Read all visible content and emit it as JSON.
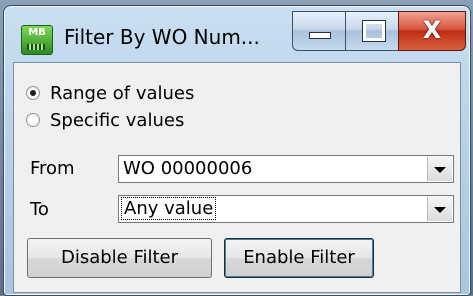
{
  "window": {
    "title": "Filter By WO Num...",
    "app_icon_text": "MB",
    "caption_buttons": {
      "minimize": "minimize",
      "maximize": "maximize",
      "close": "X"
    }
  },
  "filter_mode": {
    "options": [
      {
        "label": "Range of values",
        "checked": true
      },
      {
        "label": "Specific values",
        "checked": false
      }
    ]
  },
  "range": {
    "from_label": "From",
    "from_value": "WO 00000006",
    "to_label": "To",
    "to_value": "Any value"
  },
  "actions": {
    "disable_label": "Disable Filter",
    "enable_label": "Enable Filter"
  }
}
